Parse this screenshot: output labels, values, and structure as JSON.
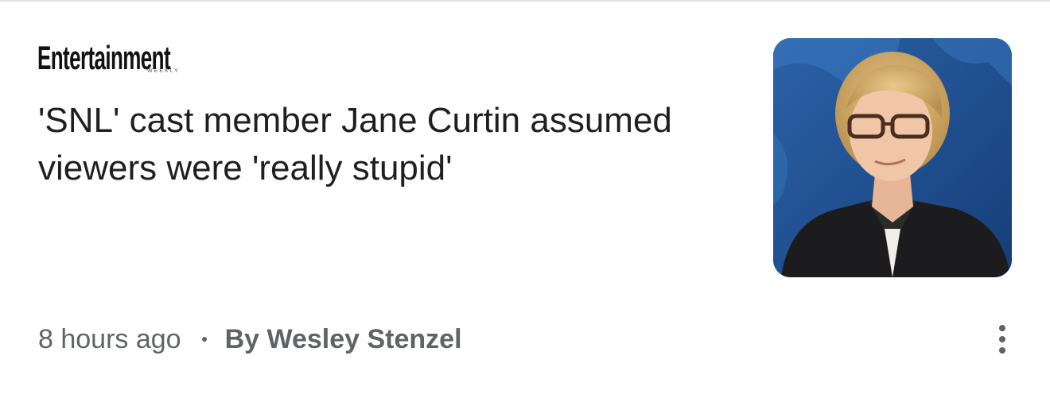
{
  "article": {
    "source": {
      "name": "Entertainment",
      "subname": "WEEKLY"
    },
    "headline": "'SNL' cast member Jane Curtin assumed viewers were 'really stupid'",
    "time": "8 hours ago",
    "author": "By Wesley Stenzel",
    "thumbnail_icon": "photo-of-woman-with-glasses",
    "more_icon": "more-vert-icon"
  }
}
